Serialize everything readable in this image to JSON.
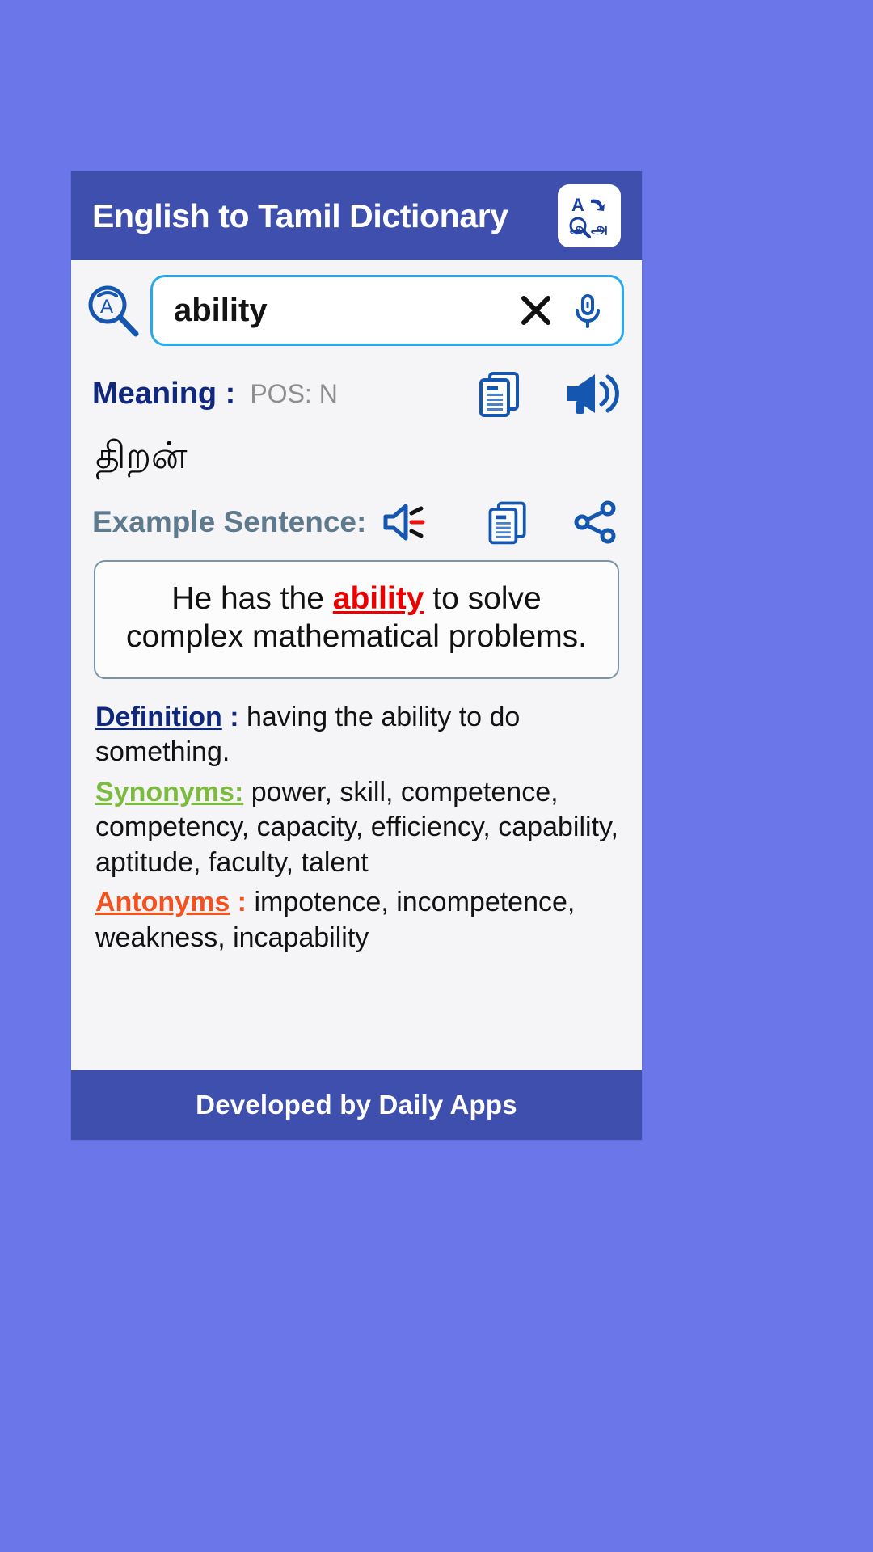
{
  "header": {
    "title": "English to Tamil Dictionary",
    "app_icon": "translate-a-to-tamil-icon",
    "bg_color": "#3f4fad",
    "title_color": "#ffffff"
  },
  "search": {
    "magnifier_icon": "search-language-icon",
    "value": "ability",
    "placeholder": "",
    "clear_icon": "close-icon",
    "mic_icon": "microphone-icon",
    "border_color": "#26a9f0"
  },
  "meaning": {
    "label": "Meaning :",
    "pos": "POS: N",
    "label_color": "#10277e",
    "pos_color": "#8d8d8d",
    "copy_icon": "copy-icon",
    "speak_icon": "megaphone-icon",
    "word": "திறன்"
  },
  "example": {
    "label": "Example Sentence:",
    "label_color": "#5f7a8c",
    "speaker_icon": "speaker-icon",
    "copy_icon": "copy-icon",
    "share_icon": "share-icon",
    "sentence_before": "He has the ",
    "sentence_highlight": "ability",
    "sentence_after": " to solve complex mathematical problems.",
    "highlight_color": "#ee0000"
  },
  "details": {
    "definition_label": "Definition",
    "definition_separator": " : ",
    "definition_text": "having the ability to do something.",
    "synonyms_label": "Synonyms:",
    "synonyms_text": " power, skill, competence, competency, capacity, efficiency, capability, aptitude, faculty, talent",
    "antonyms_label": "Antonyms",
    "antonyms_separator": " : ",
    "antonyms_text": "impotence, incompetence, weakness, incapability",
    "definition_color": "#10277e",
    "synonyms_color": "#7cbb3f",
    "antonyms_color": "#f4511e"
  },
  "footer": {
    "text": "Developed by Daily Apps",
    "bg_color": "#3f4fad",
    "text_color": "#ffffff"
  },
  "background": {
    "page_color": "#6b77e8",
    "card_color": "#f5f5f7"
  }
}
